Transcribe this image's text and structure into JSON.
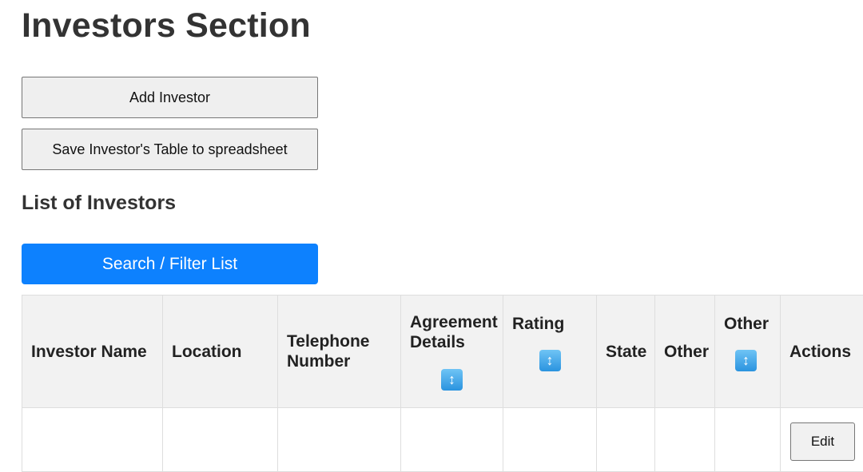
{
  "page": {
    "title": "Investors Section"
  },
  "actions": {
    "add_label": "Add Investor",
    "save_label": "Save Investor's Table to spreadsheet"
  },
  "list": {
    "title": "List of Investors",
    "filter_label": "Search / Filter List"
  },
  "table": {
    "columns": [
      {
        "label": "Investor Name",
        "sortable": false
      },
      {
        "label": "Location",
        "sortable": false
      },
      {
        "label": "Telephone Number",
        "sortable": false
      },
      {
        "label": "Agreement Details",
        "sortable": true
      },
      {
        "label": "Rating",
        "sortable": true
      },
      {
        "label": "State",
        "sortable": false
      },
      {
        "label": "Other",
        "sortable": false
      },
      {
        "label": "Other",
        "sortable": true
      },
      {
        "label": "Actions",
        "sortable": false
      }
    ],
    "sort_icon": "up-down-arrow-icon",
    "row_action_label": "Edit"
  }
}
